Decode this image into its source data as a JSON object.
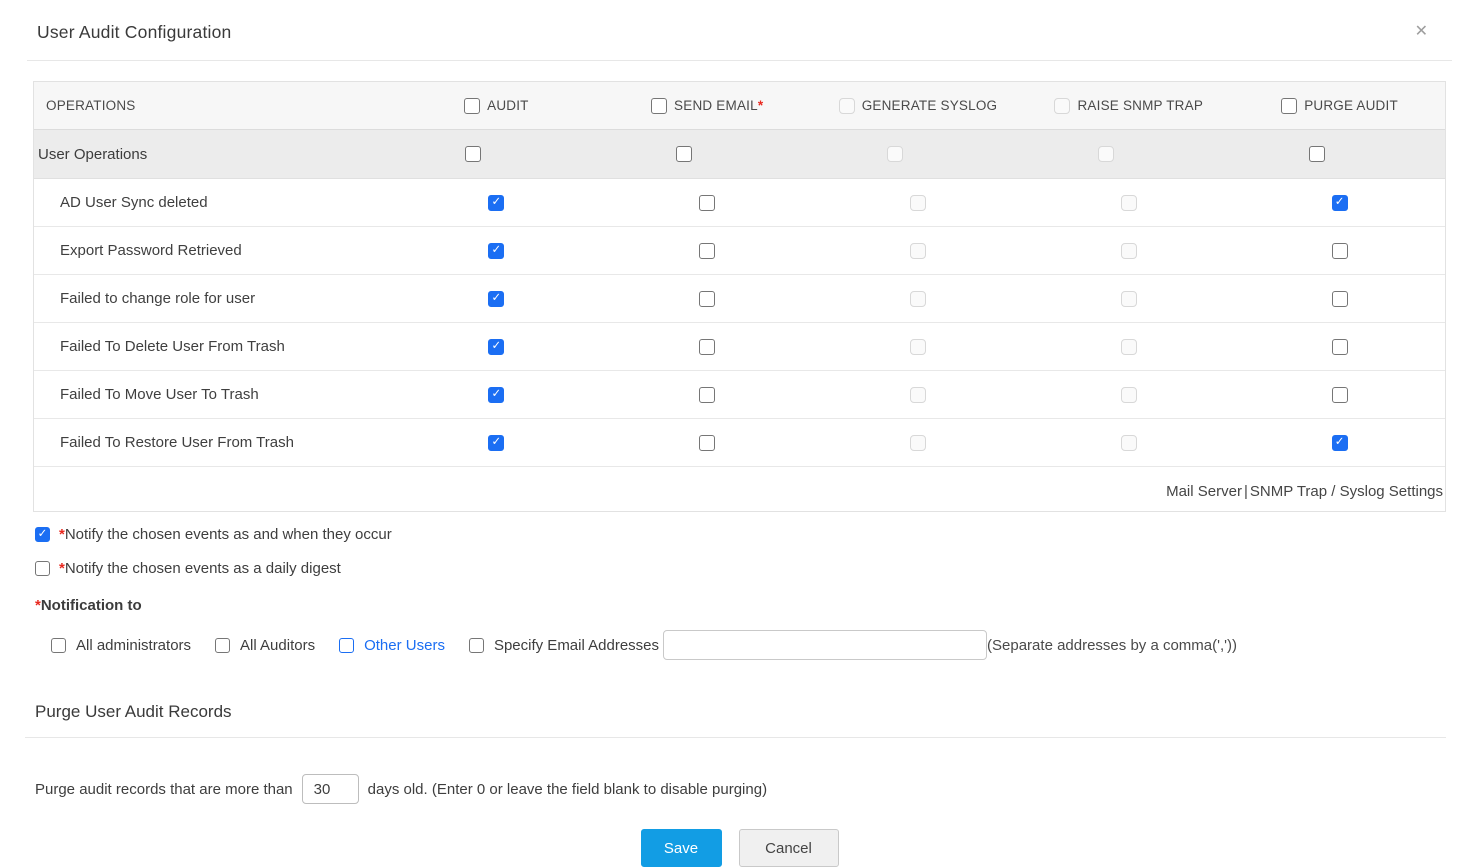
{
  "colors": {
    "accent_blue": "#1b6ef3",
    "save_button_blue": "#129de4",
    "required_red": "#e8281e"
  },
  "dialog": {
    "title": "User Audit Configuration",
    "close_glyph": "✕"
  },
  "table": {
    "columns": [
      {
        "label": "OPERATIONS"
      },
      {
        "label": "AUDIT",
        "state": "unchecked"
      },
      {
        "label": "SEND EMAIL",
        "required_mark": "*",
        "state": "unchecked"
      },
      {
        "label": "GENERATE SYSLOG",
        "state": "disabled"
      },
      {
        "label": "RAISE SNMP TRAP",
        "state": "disabled"
      },
      {
        "label": "PURGE AUDIT",
        "state": "unchecked"
      }
    ],
    "group_row": {
      "label": "User Operations",
      "states": [
        "unchecked",
        "unchecked",
        "disabled",
        "disabled",
        "unchecked"
      ]
    },
    "rows": [
      {
        "label": "AD User Sync deleted",
        "states": [
          "checked",
          "unchecked",
          "disabled",
          "disabled",
          "checked"
        ]
      },
      {
        "label": "Export Password Retrieved",
        "states": [
          "checked",
          "unchecked",
          "disabled",
          "disabled",
          "unchecked"
        ]
      },
      {
        "label": "Failed to change role for user",
        "states": [
          "checked",
          "unchecked",
          "disabled",
          "disabled",
          "unchecked"
        ]
      },
      {
        "label": "Failed To Delete User From Trash",
        "states": [
          "checked",
          "unchecked",
          "disabled",
          "disabled",
          "unchecked"
        ]
      },
      {
        "label": "Failed To Move User To Trash",
        "states": [
          "checked",
          "unchecked",
          "disabled",
          "disabled",
          "unchecked"
        ]
      },
      {
        "label": "Failed To Restore User From Trash",
        "states": [
          "checked",
          "unchecked",
          "disabled",
          "disabled",
          "checked"
        ]
      }
    ],
    "footer": {
      "link1": "Mail Server",
      "separator": "|",
      "link2": "SNMP Trap / Syslog Settings"
    }
  },
  "notifications": {
    "occur": {
      "state": "checked sm",
      "required_mark": "*",
      "label": "Notify the chosen events as and when they occur"
    },
    "digest": {
      "state": "unchecked sm",
      "required_mark": "*",
      "label": "Notify the chosen events as a daily digest"
    },
    "to": {
      "required_mark": "*",
      "label": "Notification to"
    },
    "recipients": [
      {
        "label": "All administrators",
        "state": "unchecked sm"
      },
      {
        "label": "All Auditors",
        "state": "unchecked sm"
      },
      {
        "label": "Other Users",
        "state": "unchecked sm blue"
      },
      {
        "label": "Specify Email Addresses",
        "state": "unchecked sm"
      }
    ],
    "email_input_value": "",
    "separator_hint": "(Separate addresses by a comma(','))"
  },
  "purge": {
    "heading": "Purge User Audit Records",
    "text_before": "Purge audit records that are more than",
    "days_value": "30",
    "text_after": "days old. (Enter 0 or leave the field blank to disable purging)"
  },
  "actions": {
    "save": "Save",
    "cancel": "Cancel"
  }
}
